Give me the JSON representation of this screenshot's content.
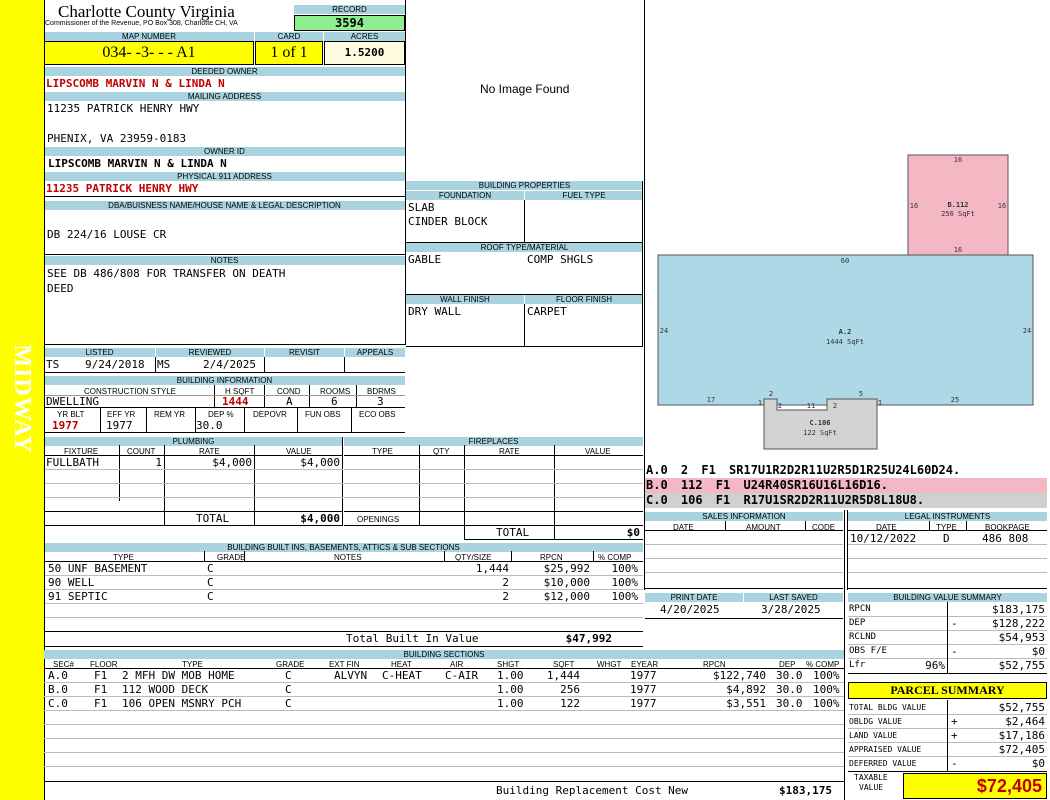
{
  "sidebar": {
    "label": "MIDWAY"
  },
  "header": {
    "county": "Charlotte County Virginia",
    "office": "Commissioner of the Revenue, PO Box 308, Charlotte CH, VA",
    "record_label": "RECORD",
    "record": "3594"
  },
  "map": {
    "map_label": "MAP NUMBER",
    "map_number": "034- -3- - - A1",
    "card_label": "CARD",
    "card": "1 of 1",
    "acres_label": "ACRES",
    "acres": "1.5200"
  },
  "owner": {
    "deeded_label": "DEEDED OWNER",
    "deeded": "LIPSCOMB MARVIN N & LINDA N",
    "mailing_label": "MAILING ADDRESS",
    "mail1": "11235 PATRICK HENRY HWY",
    "mail2": "PHENIX, VA 23959-0183",
    "owner_id_label": "OWNER ID",
    "owner_id": "LIPSCOMB MARVIN N & LINDA N",
    "phys_label": "PHYSICAL 911 ADDRESS",
    "phys": "11235 PATRICK HENRY HWY"
  },
  "dba": {
    "label": "DBA/BUISNESS NAME/HOUSE NAME & LEGAL DESCRIPTION",
    "text": "DB 224/16 LOUSE CR"
  },
  "notes": {
    "label": "NOTES",
    "line1": "SEE DB 486/808 FOR TRANSFER ON DEATH",
    "line2": "DEED"
  },
  "image": {
    "text": "No Image Found"
  },
  "listing": {
    "listed_label": "LISTED",
    "reviewed_label": "REVIEWED",
    "revisit_label": "REVISIT",
    "appeals_label": "APPEALS",
    "listed_by": "TS",
    "listed_date": "9/24/2018",
    "reviewed_by": "MS",
    "reviewed_date": "2/4/2025"
  },
  "bldg_info": {
    "label": "BUILDING INFORMATION",
    "h_style": "CONSTRUCTION STYLE",
    "h_hsqft": "H SQFT",
    "h_cond": "COND",
    "h_rooms": "ROOMS",
    "h_bdrms": "BDRMS",
    "style": "DWELLING",
    "hsqft": "1444",
    "cond": "A",
    "rooms": "6",
    "bdrms": "3",
    "h_yrblt": "YR BLT",
    "h_effyr": "EFF YR",
    "h_remyr": "REM YR",
    "h_dep": "DEP %",
    "h_depovr": "DEPOVR",
    "h_funobs": "FUN OBS",
    "h_ecoobs": "ECO OBS",
    "yrblt": "1977",
    "effyr": "1977",
    "dep": "30.0"
  },
  "props": {
    "label": "BUILDING PROPERTIES",
    "foundation_label": "FOUNDATION",
    "fuel_label": "FUEL TYPE",
    "foundation1": "SLAB",
    "foundation2": "CINDER BLOCK",
    "roof_label": "ROOF TYPE/MATERIAL",
    "roof_type": "GABLE",
    "roof_material": "COMP SHGLS",
    "wall_label": "WALL FINISH",
    "floor_label": "FLOOR FINISH",
    "wall": "DRY WALL",
    "floor": "CARPET"
  },
  "plumbing": {
    "label": "PLUMBING",
    "h_fixture": "FIXTURE",
    "h_count": "COUNT",
    "h_rate": "RATE",
    "h_value": "VALUE",
    "fixture": "FULLBATH",
    "count": "1",
    "rate": "$4,000",
    "value": "$4,000",
    "total_label": "TOTAL",
    "total": "$4,000"
  },
  "fireplaces": {
    "label": "FIREPLACES",
    "h_type": "TYPE",
    "h_qty": "QTY",
    "h_rate": "RATE",
    "h_value": "VALUE",
    "openings_label": "OPENINGS",
    "total_label": "TOTAL",
    "total": "$0"
  },
  "builtins": {
    "label": "BUILDING BUILT INS, BASEMENTS, ATTICS & SUB SECTIONS",
    "h_type": "TYPE",
    "h_grade": "GRADE",
    "h_notes": "NOTES",
    "h_qty": "QTY/SIZE",
    "h_rpcn": "RPCN",
    "h_comp": "% COMP",
    "rows": [
      {
        "type": "50 UNF BASEMENT",
        "grade": "C",
        "qty": "1,444",
        "rpcn": "$25,992",
        "comp": "100%"
      },
      {
        "type": "90 WELL",
        "grade": "C",
        "qty": "2",
        "rpcn": "$10,000",
        "comp": "100%"
      },
      {
        "type": "91 SEPTIC",
        "grade": "C",
        "qty": "2",
        "rpcn": "$12,000",
        "comp": "100%"
      }
    ],
    "total_label": "Total Built In Value",
    "total": "$47,992"
  },
  "sections": {
    "label": "BUILDING SECTIONS",
    "h_sec": "SEC#",
    "h_floor": "FLOOR",
    "h_type": "TYPE",
    "h_grade": "GRADE",
    "h_extfin": "EXT FIN",
    "h_heat": "HEAT",
    "h_air": "AIR",
    "h_shgt": "SHGT",
    "h_sqft": "SQFT",
    "h_whgt": "WHGT",
    "h_eyear": "EYEAR",
    "h_rpcn": "RPCN",
    "h_dep": "DEP",
    "h_comp": "% COMP",
    "rows": [
      {
        "sec": "A.0",
        "floor": "F1",
        "type": "2 MFH DW MOB HOME",
        "grade": "C",
        "extfin": "ALVYN",
        "heat": "C-HEAT",
        "air": "C-AIR",
        "shgt": "1.00",
        "sqft": "1,444",
        "eyear": "1977",
        "rpcn": "$122,740",
        "dep": "30.0",
        "comp": "100%"
      },
      {
        "sec": "B.0",
        "floor": "F1",
        "type": "112 WOOD DECK",
        "grade": "C",
        "extfin": "",
        "heat": "",
        "air": "",
        "shgt": "1.00",
        "sqft": "256",
        "eyear": "1977",
        "rpcn": "$4,892",
        "dep": "30.0",
        "comp": "100%"
      },
      {
        "sec": "C.0",
        "floor": "F1",
        "type": "106 OPEN MSNRY PCH",
        "grade": "C",
        "extfin": "",
        "heat": "",
        "air": "",
        "shgt": "1.00",
        "sqft": "122",
        "eyear": "1977",
        "rpcn": "$3,551",
        "dep": "30.0",
        "comp": "100%"
      }
    ],
    "brcn_label": "Building Replacement Cost New",
    "brcn": "$183,175"
  },
  "sketch": {
    "b_label": "B.112",
    "b_area": "256 SqFt",
    "a_label": "A.2",
    "a_area": "1444 SqFt",
    "c_label": "C.106",
    "c_area": "122 SqFt",
    "dims": [
      "16",
      "16",
      "16",
      "16",
      "60",
      "24",
      "24",
      "17",
      "25",
      "2",
      "2",
      "11",
      "2",
      "5",
      "1",
      "1"
    ],
    "lines": [
      {
        "code": "A.0 2 F1 SR17U1R2D2R11U2R5D1R25U24L60D24."
      },
      {
        "code": "B.0 112 F1 U24R40SR16U16L16D16."
      },
      {
        "code": "C.0 106 F1 R17U1SR2D2R11U2R5D8L18U8."
      }
    ],
    "line_colors": [
      "#ffffff",
      "#f4b8c4",
      "#d0d0d0"
    ]
  },
  "sales": {
    "label": "SALES INFORMATION",
    "h_date": "DATE",
    "h_amount": "AMOUNT",
    "h_code": "CODE"
  },
  "legal": {
    "label": "LEGAL INSTRUMENTS",
    "h_date": "DATE",
    "h_type": "TYPE",
    "h_book": "BOOKPAGE",
    "date": "10/12/2022",
    "type": "D",
    "book": "486 808"
  },
  "print": {
    "print_label": "PRINT DATE",
    "saved_label": "LAST SAVED",
    "print_date": "4/20/2025",
    "saved_date": "3/28/2025"
  },
  "bvs": {
    "label": "BUILDING VALUE SUMMARY",
    "rows": [
      {
        "k": "RPCN",
        "s": "",
        "v": "$183,175"
      },
      {
        "k": "DEP",
        "s": "-",
        "v": "$128,222"
      },
      {
        "k": "RCLND",
        "s": "",
        "v": "$54,953"
      },
      {
        "k": "OBS F/E",
        "s": "-",
        "v": "$0"
      },
      {
        "k": "Lfr",
        "p": "96%",
        "s": "",
        "v": "$52,755"
      }
    ]
  },
  "parcel": {
    "label": "PARCEL SUMMARY",
    "rows": [
      {
        "k": "TOTAL BLDG VALUE",
        "s": "",
        "v": "$52,755"
      },
      {
        "k": "OBLDG VALUE",
        "s": "+",
        "v": "$2,464"
      },
      {
        "k": "LAND VALUE",
        "s": "+",
        "v": "$17,186"
      },
      {
        "k": "APPRAISED VALUE",
        "s": "",
        "v": "$72,405"
      },
      {
        "k": "DEFERRED VALUE",
        "s": "-",
        "v": "$0"
      }
    ],
    "taxable_label1": "TAXABLE",
    "taxable_label2": "VALUE",
    "taxable": "$72,405"
  }
}
